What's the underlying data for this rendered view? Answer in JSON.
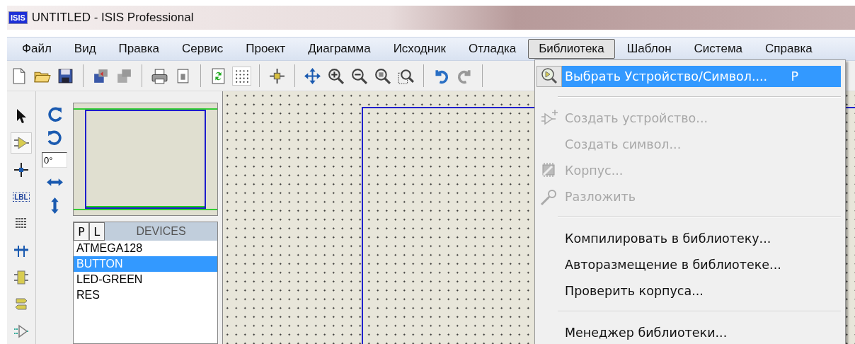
{
  "window": {
    "logo": "ISIS",
    "title": "UNTITLED - ISIS Professional"
  },
  "menu_bar": [
    {
      "label": "Файл",
      "selected": false
    },
    {
      "label": "Вид",
      "selected": false
    },
    {
      "label": "Правка",
      "selected": false
    },
    {
      "label": "Сервис",
      "selected": false
    },
    {
      "label": "Проект",
      "selected": false
    },
    {
      "label": "Диаграмма",
      "selected": false
    },
    {
      "label": "Исходник",
      "selected": false
    },
    {
      "label": "Отладка",
      "selected": false
    },
    {
      "label": "Библиотека",
      "selected": true
    },
    {
      "label": "Шаблон",
      "selected": false
    },
    {
      "label": "Система",
      "selected": false
    },
    {
      "label": "Справка",
      "selected": false
    }
  ],
  "mode_tools": [
    {
      "kind": "select",
      "selected": false
    },
    {
      "kind": "component",
      "selected": true
    },
    {
      "kind": "junction",
      "selected": false
    },
    {
      "kind": "label",
      "label": "LBL",
      "selected": false
    },
    {
      "kind": "text",
      "selected": false
    },
    {
      "kind": "bus",
      "selected": false
    },
    {
      "kind": "subcircuit",
      "selected": false
    },
    {
      "kind": "terminal",
      "selected": false
    },
    {
      "kind": "port",
      "selected": false
    }
  ],
  "rotation": {
    "value": "0°"
  },
  "devices_panel": {
    "tabs": [
      {
        "label": "P"
      },
      {
        "label": "L"
      }
    ],
    "title": "DEVICES",
    "items": [
      {
        "label": "ATMEGA128",
        "selected": false
      },
      {
        "label": "BUTTON",
        "selected": true
      },
      {
        "label": "LED-GREEN",
        "selected": false
      },
      {
        "label": "RES",
        "selected": false
      }
    ]
  },
  "library_menu": [
    {
      "kind": "command",
      "label": "Выбрать Устройство/Символ....",
      "shortcut": "P",
      "disabled": false,
      "selected": true
    },
    {
      "kind": "separator"
    },
    {
      "kind": "command",
      "label": "Создать устройство...",
      "disabled": true,
      "selected": false
    },
    {
      "kind": "command",
      "label": "Создать символ...",
      "disabled": true,
      "selected": false
    },
    {
      "kind": "command",
      "label": "Корпус...",
      "disabled": true,
      "selected": false
    },
    {
      "kind": "command",
      "label": "Разложить",
      "disabled": true,
      "selected": false
    },
    {
      "kind": "separator"
    },
    {
      "kind": "command",
      "label": "Компилировать в библиотеку...",
      "disabled": false,
      "selected": false
    },
    {
      "kind": "command",
      "label": "Авторазмещение в библиотеке...",
      "disabled": false,
      "selected": false
    },
    {
      "kind": "command",
      "label": "Проверить корпуса...",
      "disabled": false,
      "selected": false
    },
    {
      "kind": "separator"
    },
    {
      "kind": "command",
      "label": "Менеджер библиотеки...",
      "disabled": false,
      "selected": false
    }
  ]
}
